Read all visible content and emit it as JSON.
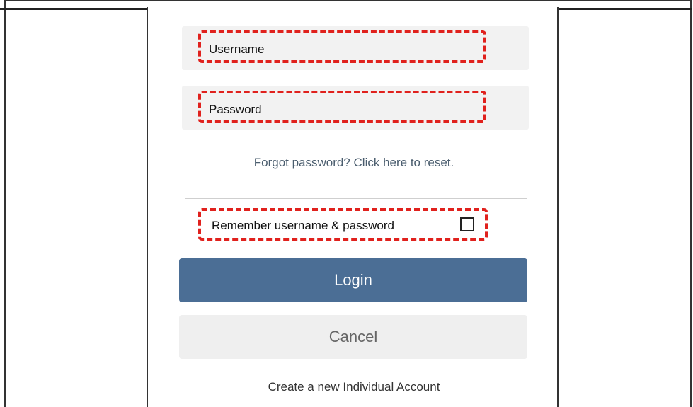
{
  "form": {
    "username_placeholder": "Username",
    "password_placeholder": "Password",
    "forgot_link": "Forgot password? Click here to reset.",
    "remember_label": "Remember username & password",
    "remember_checked": false,
    "login_label": "Login",
    "cancel_label": "Cancel",
    "create_account_link": "Create a new Individual Account"
  },
  "colors": {
    "highlight": "#e0211d",
    "login_button": "#4b6e95",
    "field_background": "#f2f2f2",
    "cancel_button": "#efefef"
  }
}
